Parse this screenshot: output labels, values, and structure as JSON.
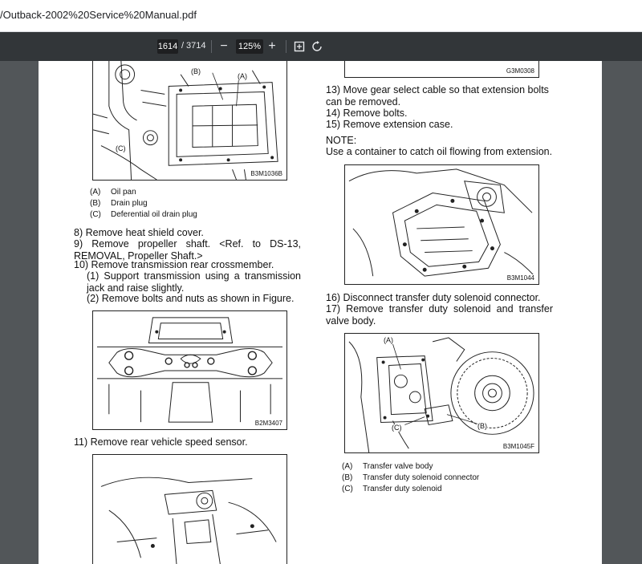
{
  "browser": {
    "url": "/Outback-2002%20Service%20Manual.pdf"
  },
  "toolbar": {
    "current_page": "1614",
    "page_separator": "/",
    "total_pages": "3714",
    "zoom_out": "−",
    "zoom_level": "125%",
    "zoom_in": "+",
    "fit_icon": "fit-to-page-icon",
    "rotate_icon": "rotate-icon"
  },
  "page": {
    "left": {
      "fig1_code": "B3M1036B",
      "fig1_callout_a": "(A)",
      "fig1_callout_b": "(B)",
      "fig1_callout_c": "(C)",
      "fig1_legend": [
        {
          "key": "(A)",
          "text": "Oil pan"
        },
        {
          "key": "(B)",
          "text": "Drain plug"
        },
        {
          "key": "(C)",
          "text": "Deferential oil drain plug"
        }
      ],
      "step8": "8) Remove heat shield cover.",
      "step9": "9) Remove propeller shaft. <Ref. to DS-13, REMOVAL, Propeller Shaft.>",
      "step10": "10) Remove transmission rear crossmember.",
      "step10_1": "(1) Support transmission using a transmission jack and raise slightly.",
      "step10_2": "(2) Remove bolts and nuts as shown in Figure.",
      "fig2_code": "B2M3407",
      "step11": "11) Remove rear vehicle speed sensor."
    },
    "right": {
      "fig0_code": "G3M0308",
      "step13": "13) Move gear select cable so that extension bolts can be removed.",
      "step14": "14) Remove bolts.",
      "step15": "15) Remove extension case.",
      "note_title": "NOTE:",
      "note_text": "Use a container to catch oil flowing from extension.",
      "fig3_code": "B3M1044",
      "step16": "16) Disconnect transfer duty solenoid connector.",
      "step17": "17) Remove transfer duty solenoid and transfer valve body.",
      "fig4_code": "B3M1045F",
      "fig4_callout_a": "(A)",
      "fig4_callout_b": "(B)",
      "fig4_callout_c": "(C)",
      "fig4_legend": [
        {
          "key": "(A)",
          "text": "Transfer valve body"
        },
        {
          "key": "(B)",
          "text": "Transfer duty solenoid connector"
        },
        {
          "key": "(C)",
          "text": "Transfer duty solenoid"
        }
      ]
    }
  }
}
